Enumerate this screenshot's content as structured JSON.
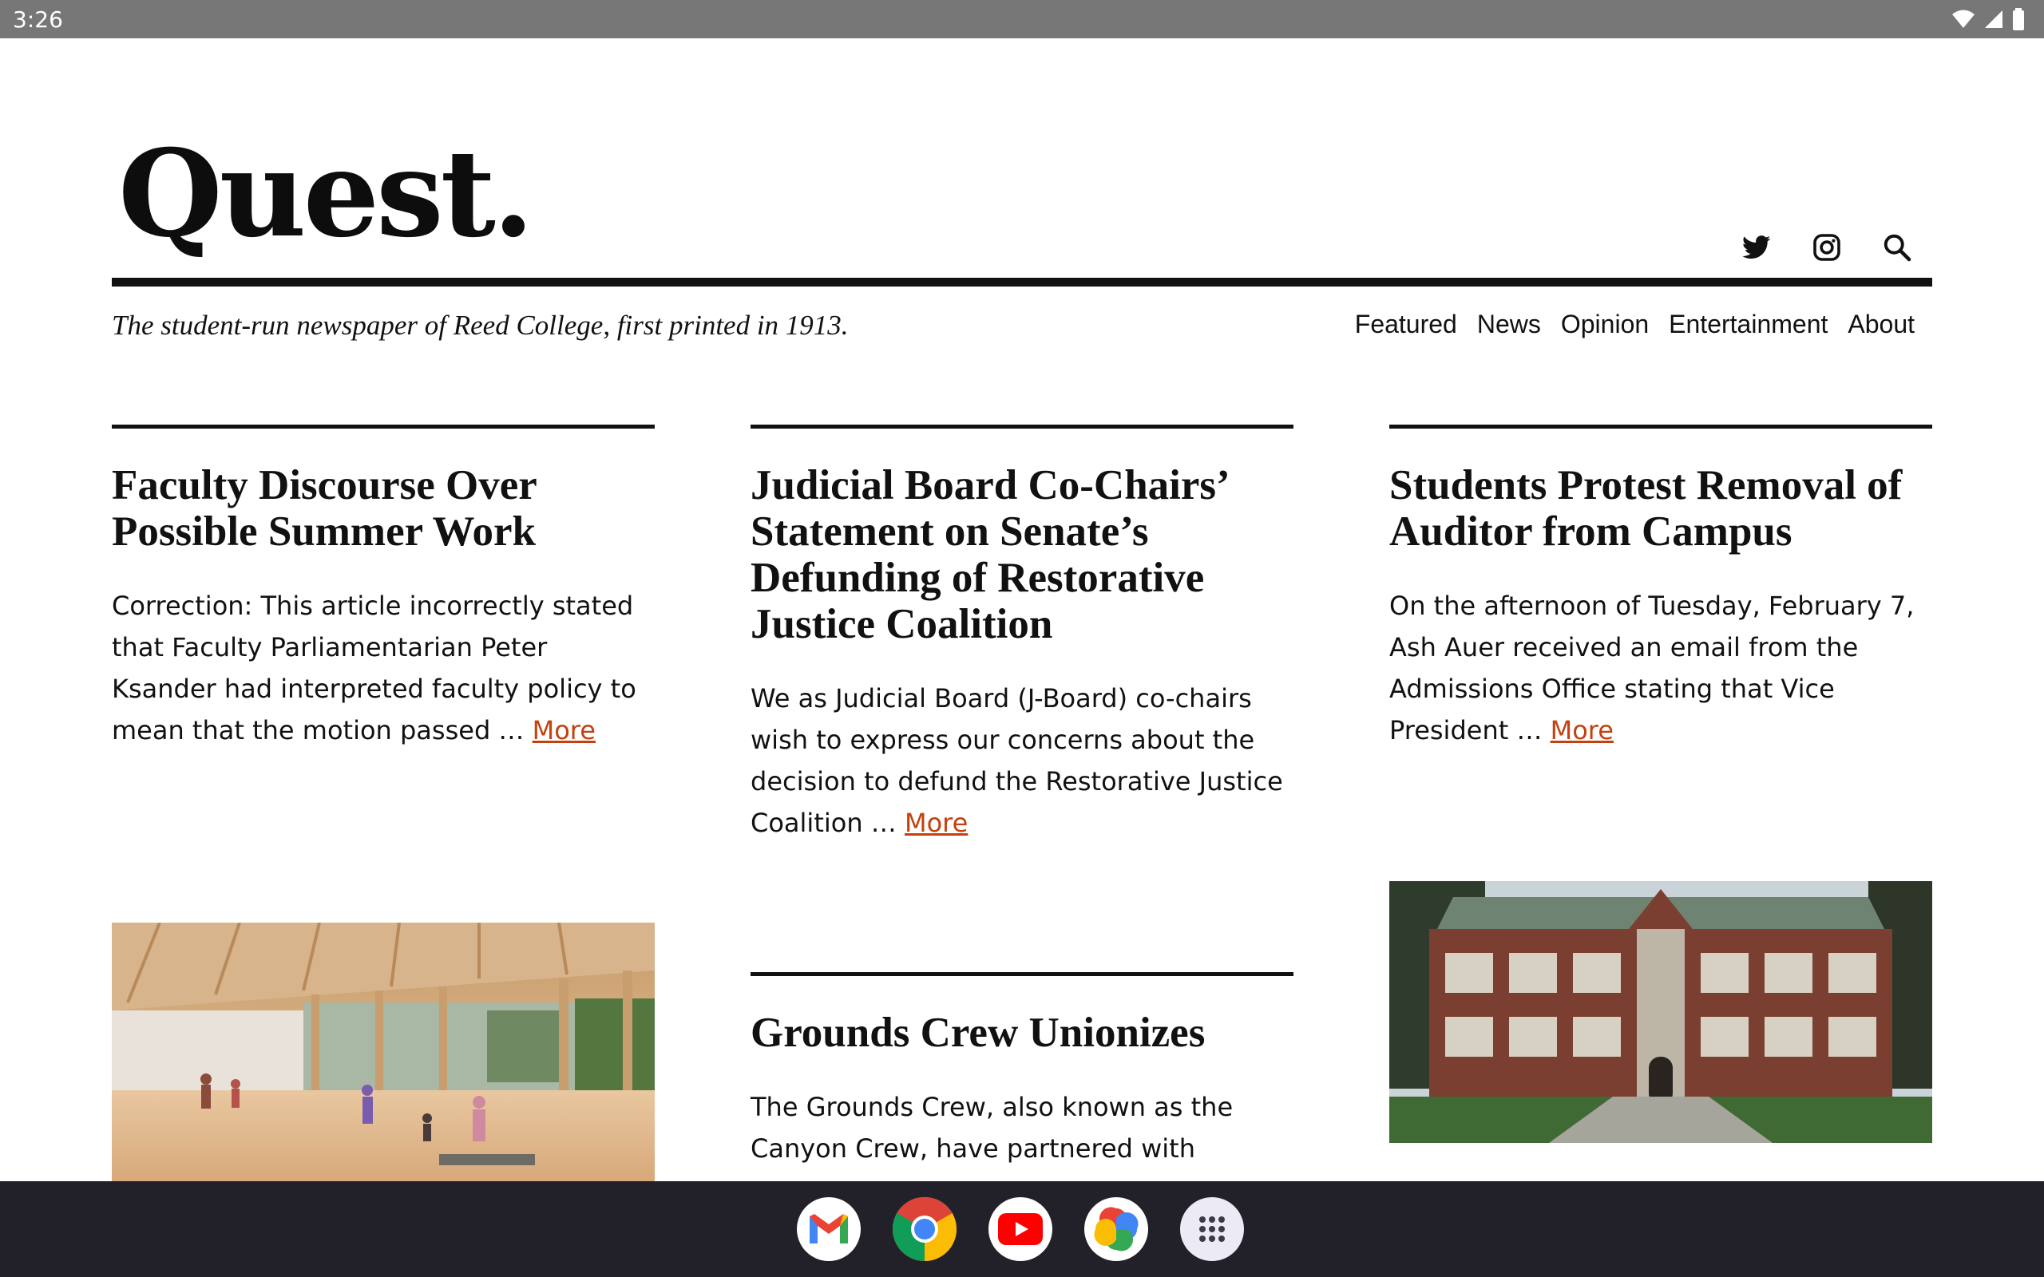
{
  "status_bar": {
    "time": "3:26"
  },
  "masthead": {
    "logo": "Quest.",
    "tagline": "The student-run newspaper of Reed College, first printed in 1913.",
    "nav": [
      "Featured",
      "News",
      "Opinion",
      "Entertainment",
      "About"
    ]
  },
  "articles": [
    {
      "title": "Faculty Discourse Over Possible Summer Work",
      "excerpt": "Correction: This article incorrectly stated that Faculty Parliamentarian Peter Ksander had interpreted faculty policy to mean that the motion passed … ",
      "more": "More"
    },
    {
      "title": "Judicial Board Co-Chairs’ Statement on Senate’s Defunding of Restorative Justice Coalition",
      "excerpt": "We as Judicial Board (J-Board) co-chairs wish to express our concerns about the decision to defund the Restorative Justice Coalition … ",
      "more": "More"
    },
    {
      "title": "Students Protest Removal of Auditor from Campus",
      "excerpt": "On the afternoon of Tuesday, February 7, Ash Auer received an email from the Admissions Office stating that Vice President … ",
      "more": "More"
    },
    {
      "title": "Grounds Crew Unionizes",
      "excerpt": "The Grounds Crew, also known as the Canyon Crew, have partnered with"
    }
  ],
  "dock": {
    "apps": [
      "gmail-icon",
      "chrome-icon",
      "youtube-icon",
      "photos-icon",
      "app-drawer-icon"
    ]
  },
  "colors": {
    "link": "#c4410f",
    "status_bar": "#777777",
    "dock": "#22212a"
  }
}
